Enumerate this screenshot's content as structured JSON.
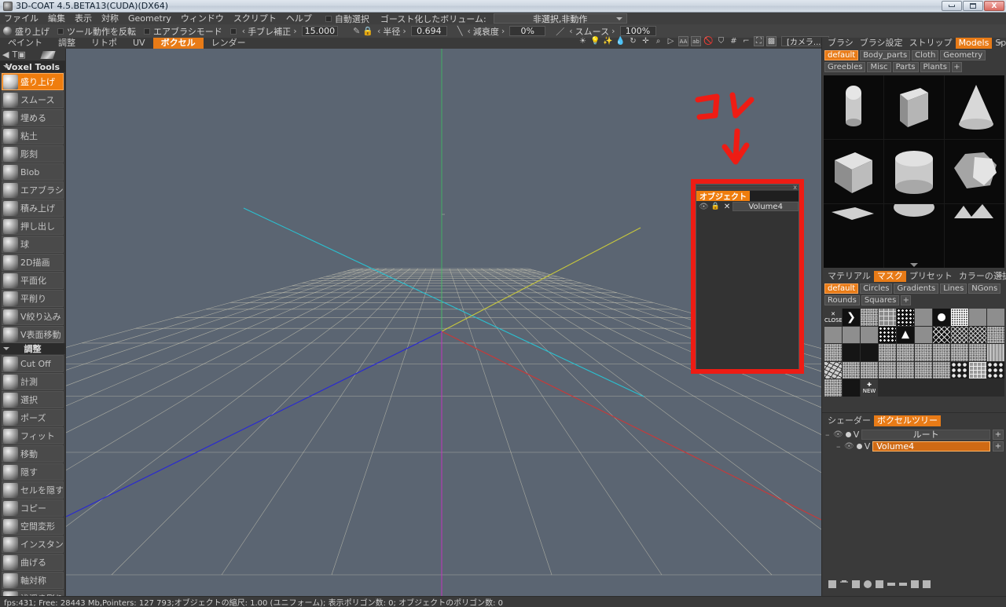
{
  "window": {
    "title": "3D-COAT 4.5.BETA13(CUDA)(DX64)",
    "minimize_label": "minimize",
    "maximize_label": "maximize",
    "close_label": "X"
  },
  "menubar": {
    "items": [
      "ファイル",
      "編集",
      "表示",
      "対称",
      "Geometry",
      "ウィンドウ",
      "スクリプト",
      "ヘルプ"
    ],
    "auto_select_label": "自動選択",
    "ghost_volume_label": "ゴースト化したボリューム:",
    "ghost_volume_value": "非選択,非動作"
  },
  "toolbar": {
    "tool_name": "盛り上げ",
    "invert_tool_label": "ツール動作を反転",
    "airbrush_label": "エアブラシモード",
    "stabilizer_label": "手ブレ補正",
    "stabilizer_value": "15.000",
    "radius_label": "半径",
    "radius_value": "0.694",
    "falloff_label": "減衰度",
    "falloff_value": "0%",
    "smooth_label": "スムース",
    "smooth_value": "100%"
  },
  "room_tabs": {
    "items": [
      "ペイント",
      "調整",
      "リトポ",
      "UV",
      "ボクセル",
      "レンダー"
    ],
    "active": "ボクセル"
  },
  "viewport_icons": {
    "camera_label": "[カメラ...]",
    "icons": [
      "light-icon",
      "bulb-icon",
      "spark-icon",
      "drop-icon",
      "rotate-icon",
      "move-icon",
      "zoom-icon",
      "play-icon",
      "bracket-left-icon",
      "bracket-right-icon",
      "no-icon",
      "shield-icon",
      "grid-icon",
      "angle-icon",
      "fullscreen-icon",
      "image-icon"
    ]
  },
  "left_panel": {
    "header_label": "Voxel Tools",
    "top_icons": [
      "back-arrow-icon",
      "text-icon",
      "brush-preview-icon"
    ],
    "sections": [
      {
        "title": "Voxel Tools",
        "tools": [
          {
            "label": "盛り上げ",
            "active": true
          },
          {
            "label": "スムース",
            "active": false
          },
          {
            "label": "埋める",
            "active": false
          },
          {
            "label": "粘土",
            "active": false
          },
          {
            "label": "彫刻",
            "active": false
          },
          {
            "label": "Blob",
            "active": false
          },
          {
            "label": "エアブラシ",
            "active": false
          },
          {
            "label": "積み上げ",
            "active": false
          },
          {
            "label": "押し出し",
            "active": false
          },
          {
            "label": "球",
            "active": false
          },
          {
            "label": "2D描画",
            "active": false
          },
          {
            "label": "平面化",
            "active": false
          },
          {
            "label": "平削り",
            "active": false
          },
          {
            "label": "V絞り込み",
            "active": false
          },
          {
            "label": "V表面移動",
            "active": false
          }
        ]
      },
      {
        "title": "調整",
        "tools": [
          {
            "label": "Cut Off",
            "active": false
          },
          {
            "label": "計測",
            "active": false
          },
          {
            "label": "選択",
            "active": false
          },
          {
            "label": "ポーズ",
            "active": false
          },
          {
            "label": "フィット",
            "active": false
          },
          {
            "label": "移動",
            "active": false
          },
          {
            "label": "隠す",
            "active": false
          },
          {
            "label": "セルを隠す",
            "active": false
          },
          {
            "label": "コピー",
            "active": false
          },
          {
            "label": "空間変形",
            "active": false
          },
          {
            "label": "インスタンス",
            "active": false
          },
          {
            "label": "曲げる",
            "active": false
          },
          {
            "label": "軸対称",
            "active": false
          },
          {
            "label": "浅浮き彫り",
            "active": false
          }
        ]
      }
    ]
  },
  "right_panel": {
    "brush_tabs": {
      "items": [
        "ブラシ",
        "ブラシ設定",
        "ストリップ",
        "Models",
        "Splines"
      ],
      "active": "Models"
    },
    "model_categories": [
      "default",
      "Body_parts",
      "Cloth",
      "Geometry",
      "Greebles",
      "Misc",
      "Parts",
      "Plants"
    ],
    "model_category_active": "default",
    "model_add_label": "+",
    "model_thumbs": [
      "capsule",
      "box-tall",
      "cone",
      "cube",
      "cylinder",
      "hexagon",
      "partial-a",
      "partial-b",
      "partial-c"
    ],
    "mask_tabs": {
      "items": [
        "マテリアル",
        "マスク",
        "プリセット",
        "カラーの選択"
      ],
      "active": "マスク"
    },
    "mask_categories": [
      "default",
      "Circles",
      "Gradients",
      "Lines",
      "NGons",
      "Rounds",
      "Squares"
    ],
    "mask_category_active": "default",
    "mask_add_label": "+",
    "mask_close_label": "CLOSE",
    "mask_new_label": "NEW",
    "tree_tabs": {
      "items": [
        "シェーダー",
        "ボクセルツリー"
      ],
      "active": "ボクセルツリー"
    },
    "tree": {
      "root_label": "ルート",
      "child_label": "Volume4",
      "plus_label": "+",
      "v_label": "V"
    },
    "bottom_icons": [
      "new-volume-icon",
      "delete-icon",
      "duplicate-icon",
      "merge-icon",
      "clone-icon",
      "swap-icon",
      "split-icon",
      "apply-icon",
      "close-icon"
    ]
  },
  "object_panel": {
    "title": "オブジェクト",
    "close_label": "x",
    "rows": [
      {
        "eye": "eye-icon",
        "lock": "lock-icon",
        "del": "X",
        "name": "Volume4"
      }
    ]
  },
  "annotation": {
    "text": "コレ",
    "arrow": "down-arrow",
    "color": "#ee1c14"
  },
  "status_bar": {
    "text": "fps:431;  Free: 28443 Mb,Pointers: 127 793;オブジェクトの縮尺: 1.00 (ユニフォーム); 表示ポリゴン数: 0; オブジェクトのポリゴン数: 0"
  },
  "colors": {
    "accent": "#e87b17",
    "annotation_red": "#ee1c14",
    "viewport_bg": "#5b6572",
    "panel_bg": "#3a3a3a",
    "axis_x": "#c63a3a",
    "axis_y": "#2a2ad0",
    "axis_z": "#2ac0d0",
    "axis_green": "#3dbd62",
    "axis_yellow": "#c8c83c",
    "axis_magenta": "#b83ab8"
  }
}
